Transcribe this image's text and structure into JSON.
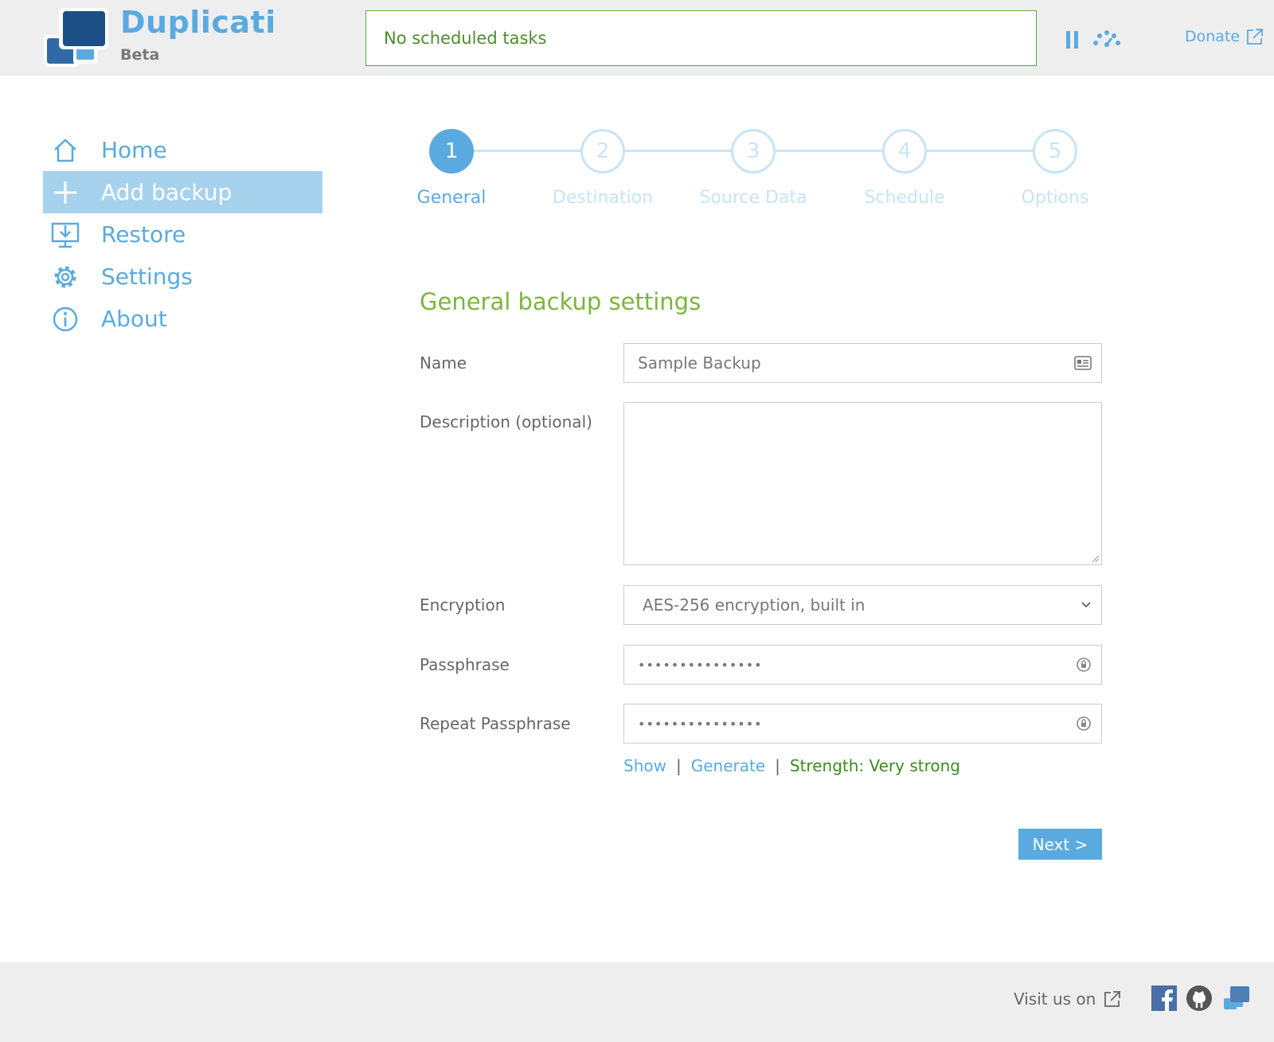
{
  "app": {
    "name": "Duplicati",
    "edition": "Beta"
  },
  "header": {
    "status_text": "No scheduled tasks",
    "donate_label": "Donate"
  },
  "nav": {
    "items": [
      {
        "label": "Home",
        "icon": "home-icon"
      },
      {
        "label": "Add backup",
        "icon": "plus-icon",
        "active": true
      },
      {
        "label": "Restore",
        "icon": "restore-icon"
      },
      {
        "label": "Settings",
        "icon": "gear-icon"
      },
      {
        "label": "About",
        "icon": "info-icon"
      }
    ]
  },
  "wizard": {
    "steps": [
      {
        "number": "1",
        "label": "General",
        "active": true
      },
      {
        "number": "2",
        "label": "Destination"
      },
      {
        "number": "3",
        "label": "Source Data"
      },
      {
        "number": "4",
        "label": "Schedule"
      },
      {
        "number": "5",
        "label": "Options"
      }
    ]
  },
  "form": {
    "title": "General backup settings",
    "name_label": "Name",
    "name_value": "Sample Backup",
    "description_label": "Description (optional)",
    "description_value": "",
    "encryption_label": "Encryption",
    "encryption_value": "AES-256 encryption, built in",
    "passphrase_label": "Passphrase",
    "passphrase_value": "•••••••••••••••",
    "repeat_label": "Repeat Passphrase",
    "repeat_value": "•••••••••••••••",
    "show_label": "Show",
    "generate_label": "Generate",
    "separator": "|",
    "strength_text": "Strength: Very strong",
    "next_label": "Next >"
  },
  "footer": {
    "visit_label": "Visit us on"
  },
  "colors": {
    "accent": "#5aaae0",
    "accent_light": "#c7e4f5",
    "nav_active": "#a6d2ee",
    "green": "#7ab63c",
    "strength_green": "#3d8a21"
  }
}
